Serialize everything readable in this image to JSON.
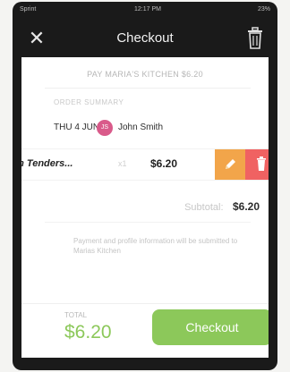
{
  "status_bar": {
    "carrier": "Sprint",
    "time": "12:17 PM",
    "battery": "23%"
  },
  "header": {
    "title": "Checkout",
    "close_icon": "close-icon",
    "trash_icon": "trash-icon"
  },
  "payment": {
    "pay_line": "PAY MARIA'S KITCHEN $6.20"
  },
  "order_summary": {
    "label": "ORDER SUMMARY",
    "date": "THU 4 JUN",
    "avatar_initials": "JS",
    "customer": "John Smith",
    "items": [
      {
        "name": "en Tenders...",
        "qty": "x1",
        "price": "$6.20"
      }
    ],
    "edit_icon": "pencil-icon",
    "delete_icon": "trash-icon"
  },
  "subtotal": {
    "label": "Subtotal:",
    "value": "$6.20"
  },
  "payment_note": "Payment and profile information will be submitted to Marias Kitchen",
  "footer": {
    "total_label": "TOTAL",
    "total_value": "$6.20",
    "checkout_label": "Checkout"
  },
  "colors": {
    "accent_green": "#8cc85a",
    "edit_orange": "#f2a54a",
    "delete_red": "#f06262",
    "avatar_pink": "#d95a8a",
    "header_dark": "#1a1a1a"
  }
}
